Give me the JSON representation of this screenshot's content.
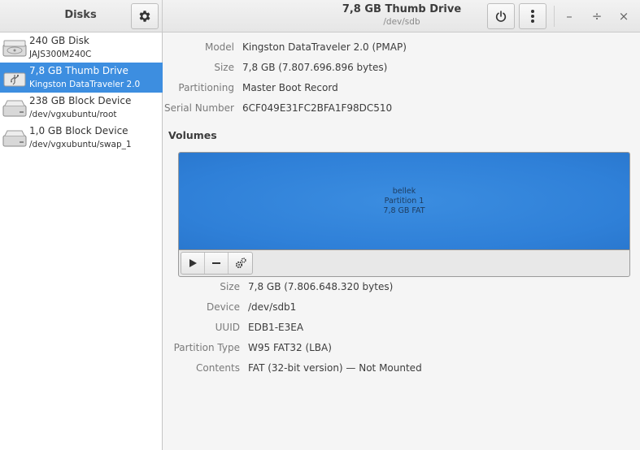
{
  "sidebar": {
    "title": "Disks",
    "settings_icon": "gear-icon",
    "devices": [
      {
        "name": "240 GB Disk",
        "detail": "JAJS300M240C",
        "icon": "hard-disk-icon",
        "selected": false
      },
      {
        "name": "7,8 GB Thumb Drive",
        "detail": "Kingston DataTraveler 2.0",
        "icon": "usb-drive-icon",
        "selected": true
      },
      {
        "name": "238 GB Block Device",
        "detail": "/dev/vgxubuntu/root",
        "icon": "block-device-icon",
        "selected": false
      },
      {
        "name": "1,0 GB Block Device",
        "detail": "/dev/vgxubuntu/swap_1",
        "icon": "block-device-icon",
        "selected": false
      }
    ]
  },
  "header": {
    "title": "7,8 GB Thumb Drive",
    "subtitle": "/dev/sdb",
    "power_icon": "power-icon",
    "menu_icon": "vertical-dots-icon",
    "window_controls": {
      "minimize": "–",
      "maximize": "÷",
      "close": "×"
    }
  },
  "drive": {
    "fields": [
      {
        "label": "Model",
        "value": "Kingston DataTraveler 2.0 (PMAP)"
      },
      {
        "label": "Size",
        "value": "7,8 GB (7.807.696.896 bytes)"
      },
      {
        "label": "Partitioning",
        "value": "Master Boot Record"
      },
      {
        "label": "Serial Number",
        "value": "6CF049E31FC2BFA1F98DC510"
      }
    ]
  },
  "volumes": {
    "title": "Volumes",
    "partition": {
      "line1": "bellek",
      "line2": "Partition 1",
      "line3": "7,8 GB FAT"
    },
    "toolbar": [
      "play-icon",
      "minus-icon",
      "gears-icon"
    ],
    "fields": [
      {
        "label": "Size",
        "value": "7,8 GB (7.806.648.320 bytes)"
      },
      {
        "label": "Device",
        "value": "/dev/sdb1"
      },
      {
        "label": "UUID",
        "value": "EDB1-E3EA"
      },
      {
        "label": "Partition Type",
        "value": "W95 FAT32 (LBA)"
      },
      {
        "label": "Contents",
        "value": "FAT (32-bit version) — Not Mounted"
      }
    ]
  },
  "colors": {
    "selection": "#3d8ee0",
    "partition": "#2f80d8"
  }
}
